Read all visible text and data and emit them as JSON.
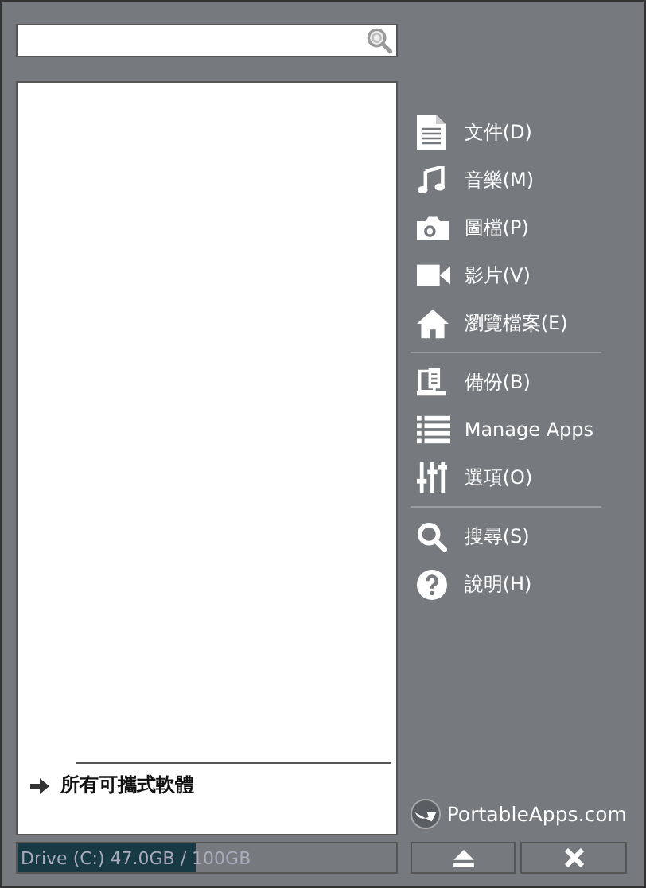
{
  "menu": [
    {
      "kind": "item",
      "label": "文件(D)"
    },
    {
      "kind": "item",
      "label": "音樂(M)"
    },
    {
      "kind": "item",
      "label": "圖檔(P)"
    },
    {
      "kind": "item",
      "label": "影片(V)"
    },
    {
      "kind": "item",
      "label": "瀏覽檔案(E)"
    },
    {
      "kind": "separator"
    },
    {
      "kind": "item",
      "label": "備份(B)"
    },
    {
      "kind": "item",
      "label": "Manage Apps"
    },
    {
      "kind": "item",
      "label": "選項(O)"
    },
    {
      "kind": "separator"
    },
    {
      "kind": "item",
      "label": "搜尋(S)"
    },
    {
      "kind": "item",
      "label": "說明(H)"
    }
  ],
  "all_apps": {
    "label": "所有可攜式軟體"
  },
  "brand": {
    "label": "PortableApps.com"
  },
  "drive": {
    "label": "Drive (C:) 47.0GB / 100GB",
    "level": 0.47
  }
}
